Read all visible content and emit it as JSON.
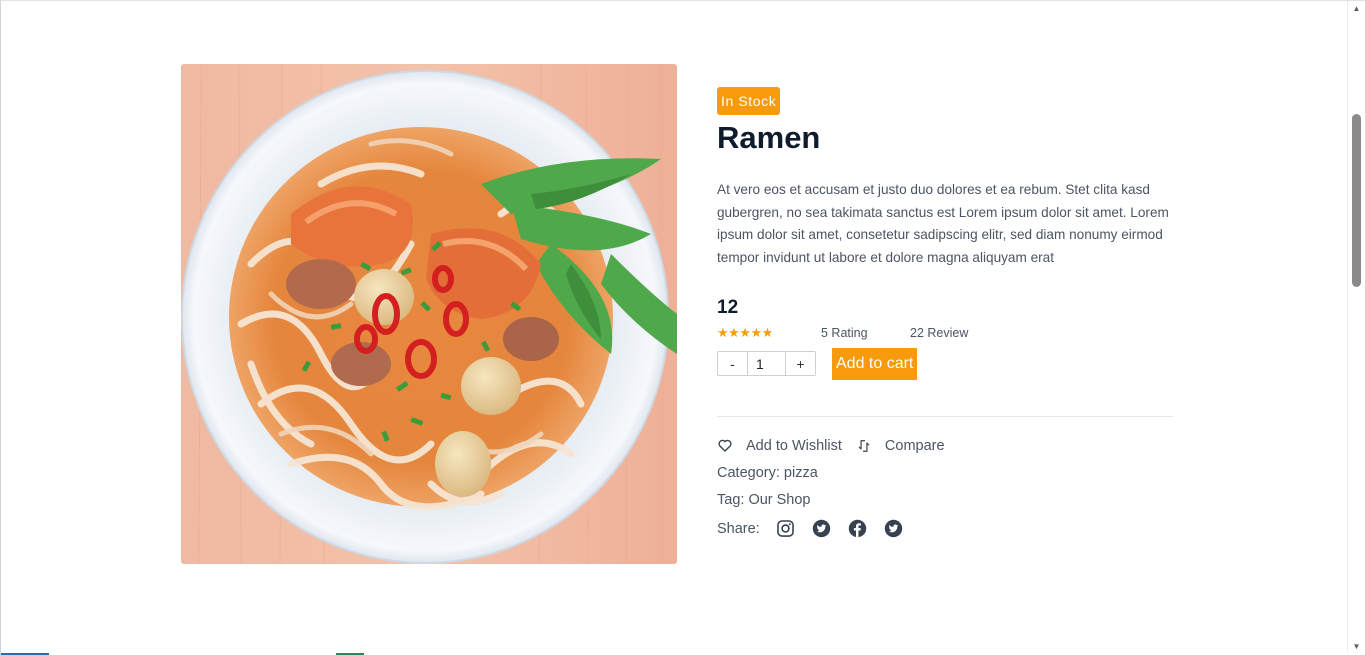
{
  "product": {
    "stock_label": "In Stock",
    "title": "Ramen",
    "description": "At vero eos et accusam et justo duo dolores et ea rebum. Stet clita kasd gubergren, no sea takimata sanctus est Lorem ipsum dolor sit amet. Lorem ipsum dolor sit amet, consetetur sadipscing elitr, sed diam nonumy eirmod tempor invidunt ut labore et dolore magna aliquyam erat",
    "price": "12",
    "stars": "★★★★★",
    "rating_count": "5 Rating",
    "review_count": "22 Review",
    "image_alt": "Bowl of ramen with shrimp, quail eggs, chili and herbs"
  },
  "cart": {
    "decrement_label": "-",
    "quantity": "1",
    "increment_label": "+",
    "add_to_cart_label": "Add to cart"
  },
  "actions": {
    "wishlist_label": "Add to Wishlist",
    "compare_label": "Compare"
  },
  "meta": {
    "category_prefix": "Category: ",
    "category_value": "pizza",
    "tag_prefix": "Tag: ",
    "tag_value": "Our Shop",
    "share_label": "Share:"
  },
  "share_icons": [
    "instagram-icon",
    "twitter-icon",
    "facebook-icon",
    "twitter-icon"
  ],
  "colors": {
    "accent": "#f79a0b",
    "title": "#0f1c2d",
    "body_text": "#4b5563",
    "star": "#f59e0b"
  }
}
